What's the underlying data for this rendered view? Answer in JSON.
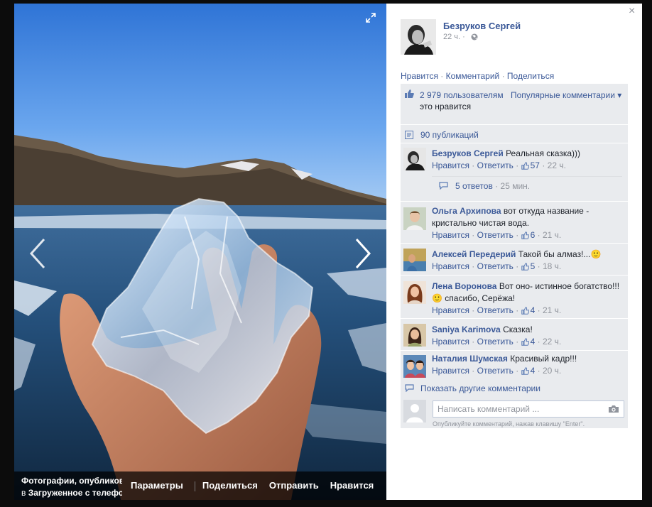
{
  "photo": {
    "bottom_bar": {
      "album_title": "Фотографии, опубликованные с телефона",
      "album_prefix": "в",
      "album_name": "Загруженное с телефона",
      "actions": [
        "Параметры",
        "Поделиться",
        "Отправить",
        "Нравится"
      ]
    },
    "icons": {
      "expand": "expand-icon",
      "prev": "chevron-left-icon",
      "next": "chevron-right-icon"
    }
  },
  "post": {
    "author": "Безруков Сергей",
    "time": "22 ч.",
    "time_sep": "·",
    "actions": {
      "like": "Нравится",
      "comment": "Комментарий",
      "share": "Поделиться",
      "sep": "·"
    },
    "likes": {
      "count": "2 979",
      "users_word": "пользователям",
      "tail": "это нравится"
    },
    "popular_comments": "Популярные комментарии ▾",
    "shares": "90 публикаций",
    "more_comments": "Показать другие комментарии",
    "compose": {
      "placeholder": "Написать комментарий ...",
      "value": "",
      "hint": "Опубликуйте комментарий, нажав клавишу \"Enter\"."
    }
  },
  "comment_labels": {
    "like": "Нравится",
    "reply": "Ответить",
    "sep": "·"
  },
  "comments": [
    {
      "author": "Безруков Сергей",
      "text": "Реальная сказка)))",
      "likes": "57",
      "time": "22 ч.",
      "replies": {
        "label": "5 ответов",
        "time": "25 мин."
      }
    },
    {
      "author": "Ольга Архипова",
      "text": "вот откуда название - кристально чистая вода.",
      "likes": "6",
      "time": "21 ч."
    },
    {
      "author": "Алексей Передерий",
      "text": "Такой бы алмаз!...",
      "emoji": "🙂",
      "likes": "5",
      "time": "18 ч."
    },
    {
      "author": "Лена Воронова",
      "text": "Вот оно- истинное богатство!!!",
      "emoji": "🙂",
      "text2": "спасибо, Серёжа!",
      "likes": "4",
      "time": "21 ч."
    },
    {
      "author": "Saniya Karimova",
      "text": "Сказка!",
      "likes": "4",
      "time": "22 ч."
    },
    {
      "author": "Наталия Шумская",
      "text": "Красивый кадр!!!",
      "likes": "4",
      "time": "20 ч."
    }
  ],
  "close_label": "×",
  "colors": {
    "link": "#3b5998",
    "ufi_bg": "#e9ebee",
    "overlay": "#0c0c0c",
    "muted": "#90949c"
  }
}
